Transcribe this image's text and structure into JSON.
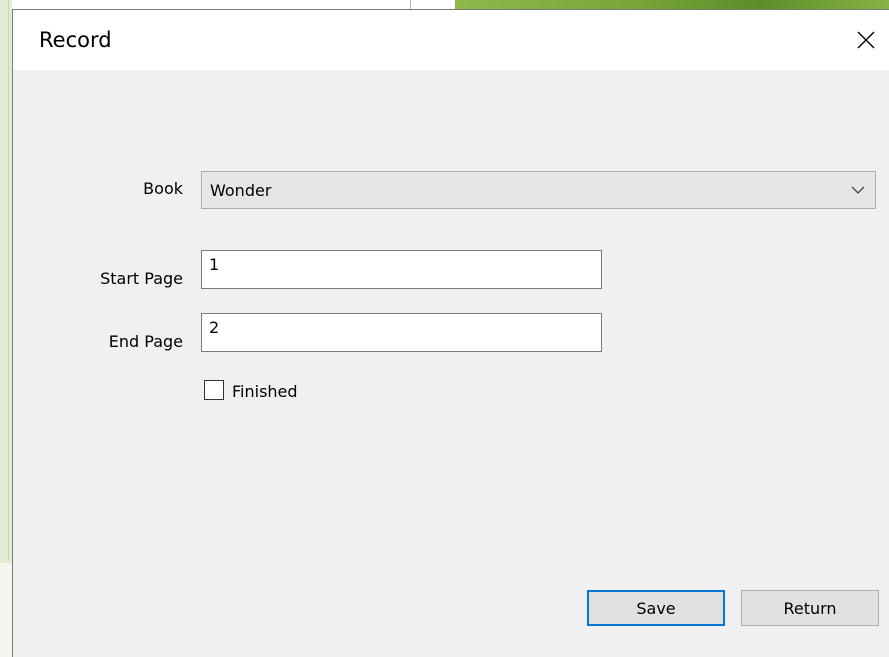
{
  "dialog": {
    "title": "Record"
  },
  "form": {
    "book_label": "Book",
    "book_value": "Wonder",
    "start_page_label": "Start Page",
    "start_page_value": "1",
    "end_page_label": "End Page",
    "end_page_value": "2",
    "finished_label": "Finished",
    "finished_checked": false
  },
  "buttons": {
    "save_label": "Save",
    "return_label": "Return"
  },
  "icons": {
    "close": "close-icon",
    "dropdown": "chevron-down-icon"
  },
  "colors": {
    "dialog_bg": "#f0f0f0",
    "titlebar_bg": "#ffffff",
    "default_button_border": "#0078d7",
    "background_accent": "#7aa63a"
  }
}
